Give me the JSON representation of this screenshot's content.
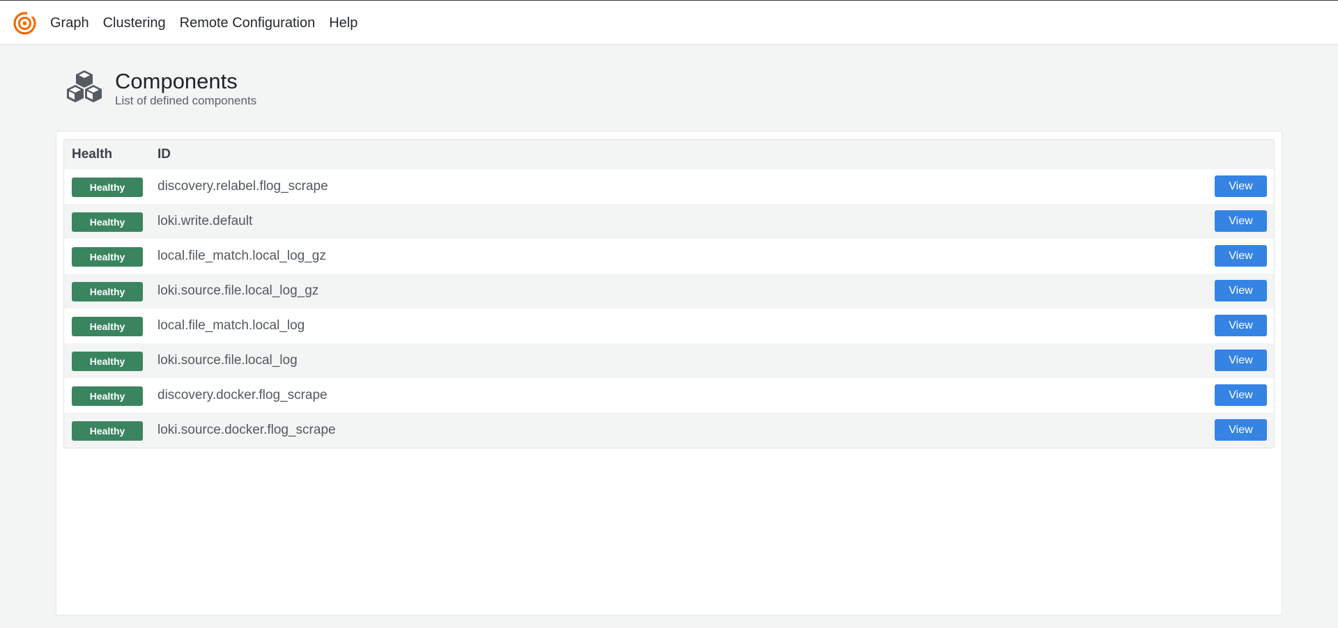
{
  "nav": {
    "items": [
      {
        "label": "Graph"
      },
      {
        "label": "Clustering"
      },
      {
        "label": "Remote Configuration"
      },
      {
        "label": "Help"
      }
    ]
  },
  "header": {
    "icon": "cubes-icon",
    "title": "Components",
    "subtitle": "List of defined components"
  },
  "table": {
    "columns": {
      "health": "Health",
      "id": "ID"
    },
    "rows": [
      {
        "health": "Healthy",
        "id": "discovery.relabel.flog_scrape",
        "action": "View"
      },
      {
        "health": "Healthy",
        "id": "loki.write.default",
        "action": "View"
      },
      {
        "health": "Healthy",
        "id": "local.file_match.local_log_gz",
        "action": "View"
      },
      {
        "health": "Healthy",
        "id": "loki.source.file.local_log_gz",
        "action": "View"
      },
      {
        "health": "Healthy",
        "id": "local.file_match.local_log",
        "action": "View"
      },
      {
        "health": "Healthy",
        "id": "loki.source.file.local_log",
        "action": "View"
      },
      {
        "health": "Healthy",
        "id": "discovery.docker.flog_scrape",
        "action": "View"
      },
      {
        "health": "Healthy",
        "id": "loki.source.docker.flog_scrape",
        "action": "View"
      }
    ]
  },
  "colors": {
    "accent": "#3584e4",
    "healthy": "#3a8560",
    "logo": "#f46800"
  }
}
